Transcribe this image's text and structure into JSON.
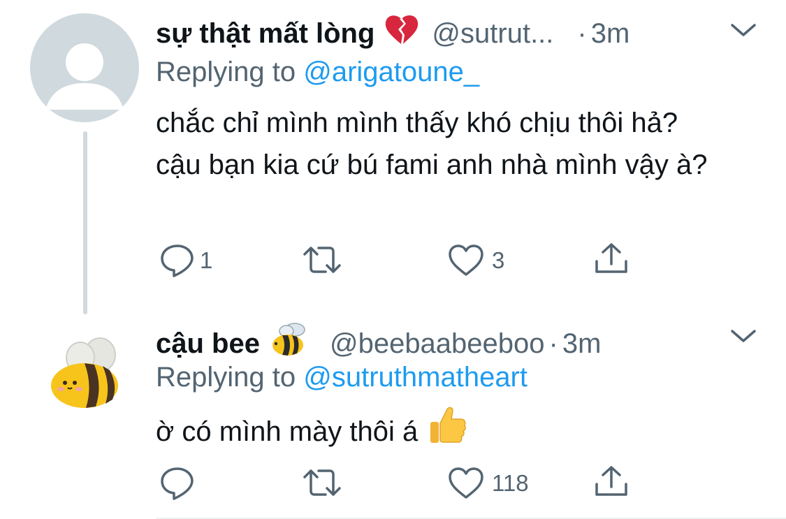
{
  "tweets": [
    {
      "name": "sự thật mất lòng",
      "name_emoji": "broken-heart-emoji",
      "handle": "@sutrut...",
      "separator": "·",
      "time": "3m",
      "replying_prefix": "Replying to",
      "replying_to": "@arigatoune_",
      "text": "chắc chỉ mình mình thấy khó chịu thôi hả? cậu bạn kia cứ bú fami anh nhà mình vậy à?",
      "text_emoji": null,
      "replies": "1",
      "retweets": "",
      "likes": "3"
    },
    {
      "name": "cậu bee",
      "name_emoji": "bee-emoji",
      "handle": "@beebaabeeboo",
      "separator": "·",
      "time": "3m",
      "replying_prefix": "Replying to",
      "replying_to": "@sutruthmatheart",
      "text": "ờ có mình mày thôi á",
      "text_emoji": "thumbs-up-emoji",
      "replies": "",
      "retweets": "",
      "likes": "118"
    }
  ],
  "colors": {
    "text": "#0f1419",
    "secondary": "#536471",
    "link": "#1d9bf0",
    "thread_line": "#cfd9de",
    "default_avatar_bg": "#cfd9de",
    "broken_heart": "#d7263d",
    "bee_yellow": "#f7c41c"
  }
}
